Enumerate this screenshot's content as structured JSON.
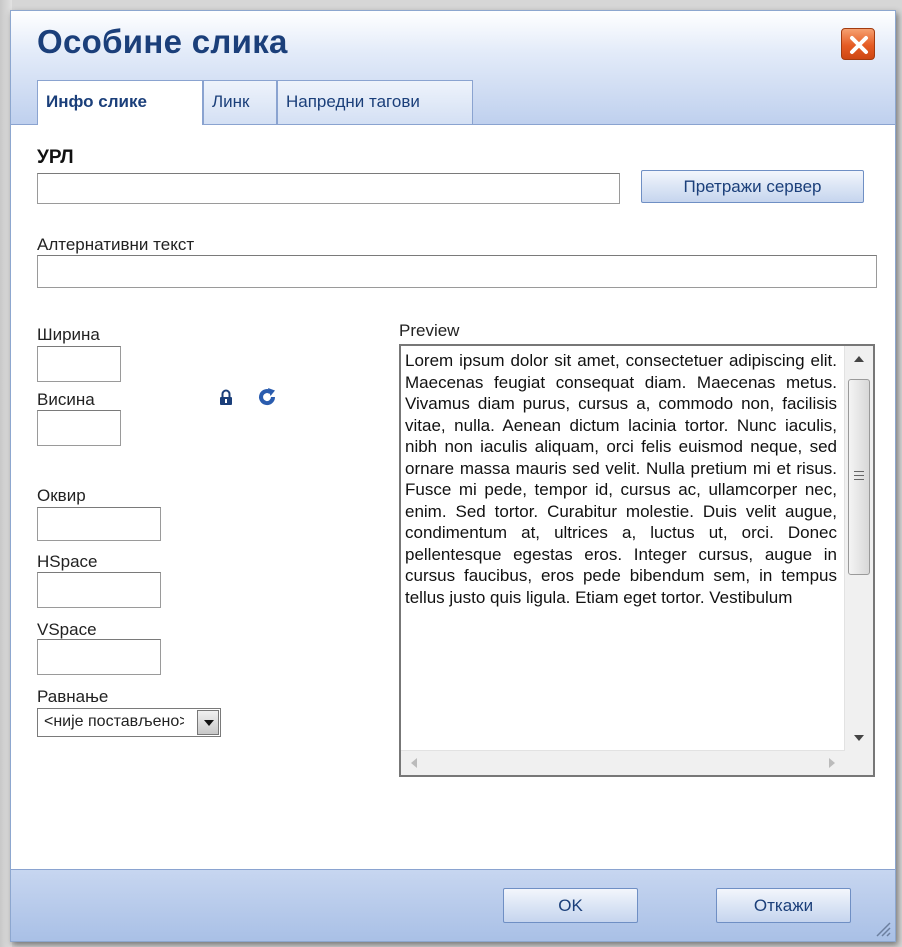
{
  "dialog": {
    "title": "Особине слика",
    "close_icon": "close-icon",
    "tabs": [
      {
        "label": "Инфо слике",
        "active": true
      },
      {
        "label": "Линк",
        "active": false
      },
      {
        "label": "Напредни тагови",
        "active": false
      }
    ]
  },
  "info": {
    "url_label": "УРЛ",
    "url_value": "",
    "browse_button": "Претражи сервер",
    "alt_label": "Алтернативни текст",
    "alt_value": "",
    "width_label": "Ширина",
    "height_label": "Висина",
    "border_label": "Оквир",
    "hspace_label": "HSpace",
    "vspace_label": "VSpace",
    "align_label": "Равнање",
    "align_value": "<није постављено>",
    "lock_icon": "lock-icon",
    "reset_icon": "reset-size-icon"
  },
  "preview": {
    "label": "Preview",
    "text": "Lorem ipsum dolor sit amet, consectetuer adipiscing elit. Maecenas feugiat consequat diam. Maecenas metus. Vivamus diam purus, cursus a, commodo non, facilisis vitae, nulla. Aenean dictum lacinia tortor. Nunc iaculis, nibh non iaculis aliquam, orci felis euismod neque, sed ornare massa mauris sed velit. Nulla pretium mi et risus. Fusce mi pede, tempor id, cursus ac, ullamcorper nec, enim. Sed tortor. Curabitur molestie. Duis velit augue, condimentum at, ultrices a, luctus ut, orci. Donec pellentesque egestas eros. Integer cursus, augue in cursus faucibus, eros pede bibendum sem, in tempus tellus justo quis ligula. Etiam eget tortor. Vestibulum"
  },
  "footer": {
    "ok_button": "OK",
    "cancel_button": "Откажи"
  }
}
